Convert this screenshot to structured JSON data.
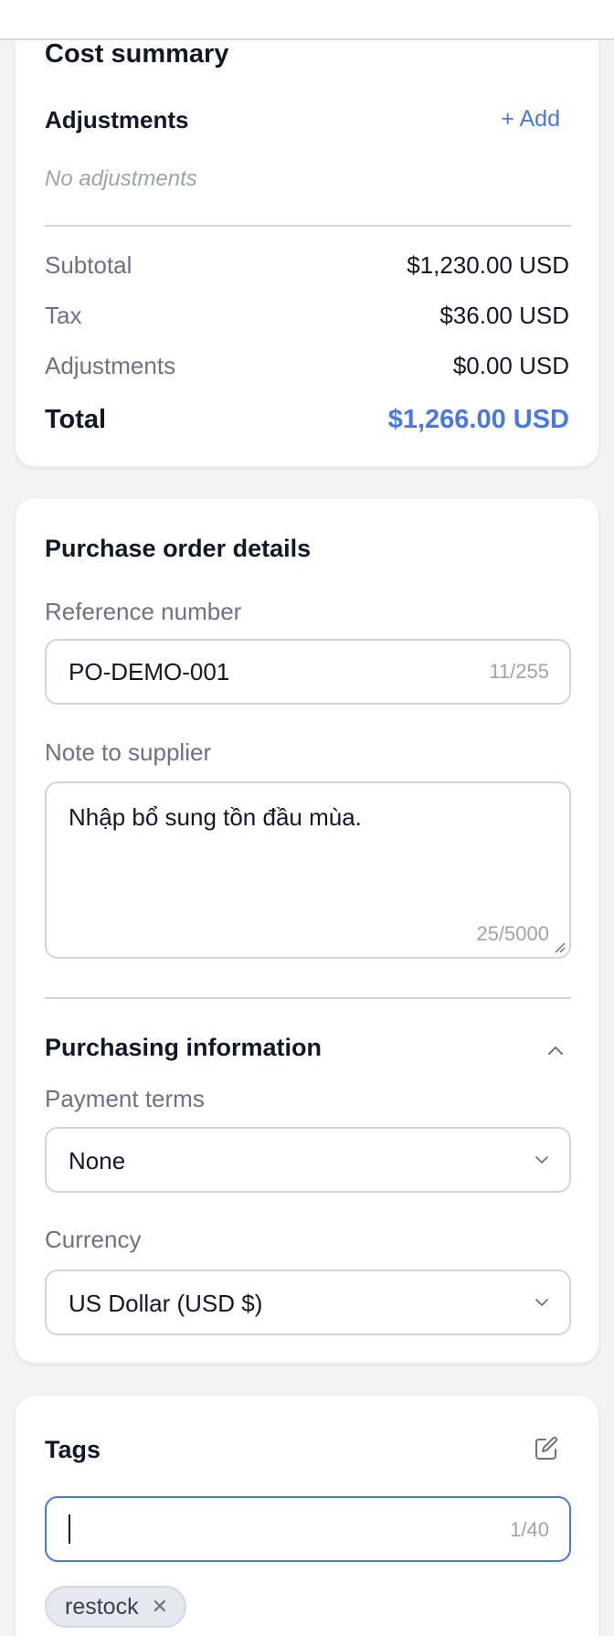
{
  "cost_summary": {
    "title": "Cost summary",
    "adjustments_heading": "Adjustments",
    "add_label": "+ Add",
    "no_adjustments": "No adjustments",
    "rows": [
      {
        "label": "Subtotal",
        "value": "$1,230.00 USD"
      },
      {
        "label": "Tax",
        "value": "$36.00 USD"
      },
      {
        "label": "Adjustments",
        "value": "$0.00 USD"
      }
    ],
    "total_label": "Total",
    "total_value": "$1,266.00 USD"
  },
  "po_details": {
    "title": "Purchase order details",
    "reference_label": "Reference number",
    "reference_value": "PO-DEMO-001",
    "reference_counter": "11/255",
    "note_label": "Note to supplier",
    "note_value": "Nhập bổ sung tồn đầu mùa.",
    "note_counter": "25/5000",
    "purchasing_title": "Purchasing information",
    "payment_terms_label": "Payment terms",
    "payment_terms_value": "None",
    "currency_label": "Currency",
    "currency_value": "US Dollar (USD $)"
  },
  "tags": {
    "title": "Tags",
    "input_value": "",
    "counter": "1/40",
    "items": [
      {
        "label": "restock"
      }
    ]
  },
  "colors": {
    "accent": "#4a78e0",
    "muted": "#6b7280",
    "border": "#d1d5db"
  },
  "icons": {
    "edit": "edit-icon",
    "chevron_up": "chevron-up-icon",
    "chevron_down": "chevron-down-icon",
    "remove": "close-icon"
  }
}
